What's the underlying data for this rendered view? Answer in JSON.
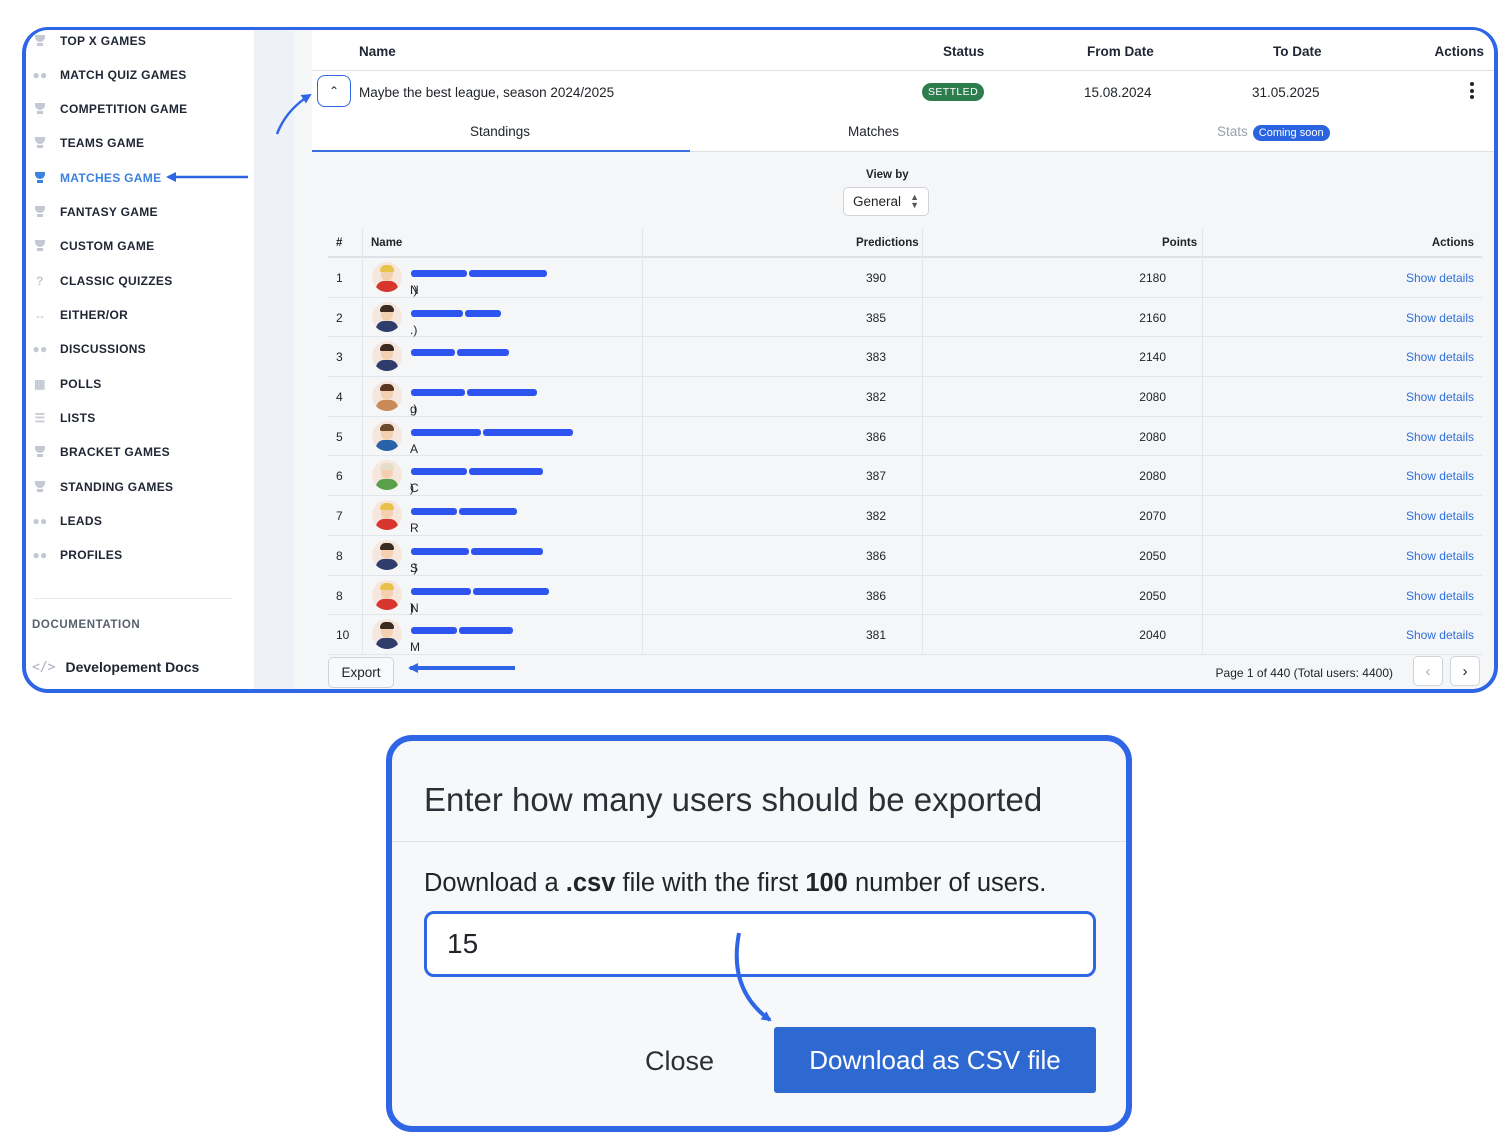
{
  "sidebar": {
    "items": [
      {
        "label": "TOP X GAMES",
        "icon": "trophy-icon"
      },
      {
        "label": "MATCH QUIZ GAMES",
        "icon": "chat-bubbles-icon"
      },
      {
        "label": "COMPETITION GAME",
        "icon": "trophy-icon"
      },
      {
        "label": "TEAMS GAME",
        "icon": "trophy-icon"
      },
      {
        "label": "MATCHES GAME",
        "icon": "trophy-icon",
        "active": true
      },
      {
        "label": "FANTASY GAME",
        "icon": "trophy-icon"
      },
      {
        "label": "CUSTOM GAME",
        "icon": "trophy-icon"
      },
      {
        "label": "CLASSIC QUIZZES",
        "icon": "question-icon"
      },
      {
        "label": "EITHER/OR",
        "icon": "arrows-horizontal-icon"
      },
      {
        "label": "DISCUSSIONS",
        "icon": "chat-bubbles-icon"
      },
      {
        "label": "POLLS",
        "icon": "bar-chart-icon"
      },
      {
        "label": "LISTS",
        "icon": "list-icon"
      },
      {
        "label": "BRACKET GAMES",
        "icon": "trophy-icon"
      },
      {
        "label": "STANDING GAMES",
        "icon": "trophy-icon"
      },
      {
        "label": "LEADS",
        "icon": "users-icon"
      },
      {
        "label": "PROFILES",
        "icon": "users-icon"
      }
    ],
    "section_heading": "DOCUMENTATION",
    "docs_link": "Developement Docs",
    "docs_icon": "code-icon"
  },
  "league_table": {
    "headers": {
      "name": "Name",
      "status": "Status",
      "from": "From Date",
      "to": "To Date",
      "actions": "Actions"
    },
    "row": {
      "name": "Maybe the best league, season 2024/2025",
      "status": "SETTLED",
      "from": "15.08.2024",
      "to": "31.05.2025"
    }
  },
  "tabs": {
    "standings": "Standings",
    "matches": "Matches",
    "stats": "Stats",
    "stats_badge": "Coming soon"
  },
  "view_by": {
    "label": "View by",
    "selected": "General"
  },
  "standings": {
    "headers": {
      "rank": "#",
      "name": "Name",
      "predictions": "Predictions",
      "points": "Points",
      "actions": "Actions"
    },
    "action_label": "Show details",
    "rows": [
      {
        "rank": "1",
        "prefix": "N",
        "suffix": ".)",
        "predictions": "390",
        "points": "2180"
      },
      {
        "rank": "2",
        "prefix": "",
        "suffix": ".)",
        "predictions": "385",
        "points": "2160"
      },
      {
        "rank": "3",
        "prefix": "",
        "suffix": "",
        "predictions": "383",
        "points": "2140"
      },
      {
        "rank": "4",
        "prefix": "g",
        "suffix": ".)",
        "predictions": "382",
        "points": "2080"
      },
      {
        "rank": "5",
        "prefix": "A",
        "suffix": "",
        "predictions": "386",
        "points": "2080"
      },
      {
        "rank": "6",
        "prefix": "C",
        "suffix": ")",
        "predictions": "387",
        "points": "2080"
      },
      {
        "rank": "7",
        "prefix": "R",
        "suffix": "",
        "predictions": "382",
        "points": "2070"
      },
      {
        "rank": "8",
        "prefix": "S",
        "suffix": ".)",
        "predictions": "386",
        "points": "2050"
      },
      {
        "rank": "8",
        "prefix": "N",
        "suffix": ")",
        "predictions": "386",
        "points": "2050"
      },
      {
        "rank": "10",
        "prefix": "M",
        "suffix": "",
        "predictions": "381",
        "points": "2040"
      }
    ]
  },
  "footer": {
    "export_label": "Export",
    "pagination_text": "Page 1 of 440 (Total users: 4400)"
  },
  "modal": {
    "title": "Enter how many users should be exported",
    "body_1": "Download a ",
    "body_ext": ".csv",
    "body_2": " file with the first ",
    "body_count": "100",
    "body_3": " number of users.",
    "input_value": "15",
    "close_label": "Close",
    "download_label": "Download as CSV file"
  },
  "colors": {
    "accent": "#2f66e6",
    "link": "#2f6fd8",
    "settled": "#2e7d4f",
    "primary_button": "#2e69d1"
  }
}
